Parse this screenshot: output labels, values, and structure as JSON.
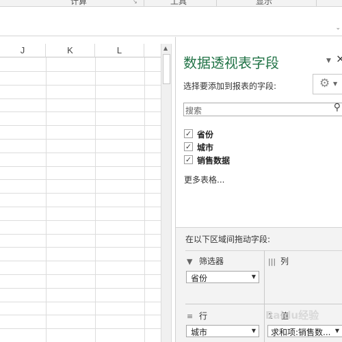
{
  "ribbon": {
    "groups": [
      "计算",
      "工具",
      "显示"
    ]
  },
  "sheet": {
    "columns": [
      "J",
      "K",
      "L"
    ]
  },
  "pivot_pane": {
    "title": "数据透视表字段",
    "choose_fields_label": "选择要添加到报表的字段:",
    "search_placeholder": "搜索",
    "fields": [
      {
        "label": "省份",
        "checked": true
      },
      {
        "label": "城市",
        "checked": true
      },
      {
        "label": "销售数据",
        "checked": true
      }
    ],
    "more_tables": "更多表格...",
    "drag_label": "在以下区域间拖动字段:",
    "areas": {
      "filters": {
        "label": "筛选器",
        "item": "省份"
      },
      "columns": {
        "label": "列"
      },
      "rows": {
        "label": "行",
        "item": "城市"
      },
      "values": {
        "label": "值",
        "item": "求和项:销售数..."
      }
    }
  },
  "watermark": "Baidu经验"
}
